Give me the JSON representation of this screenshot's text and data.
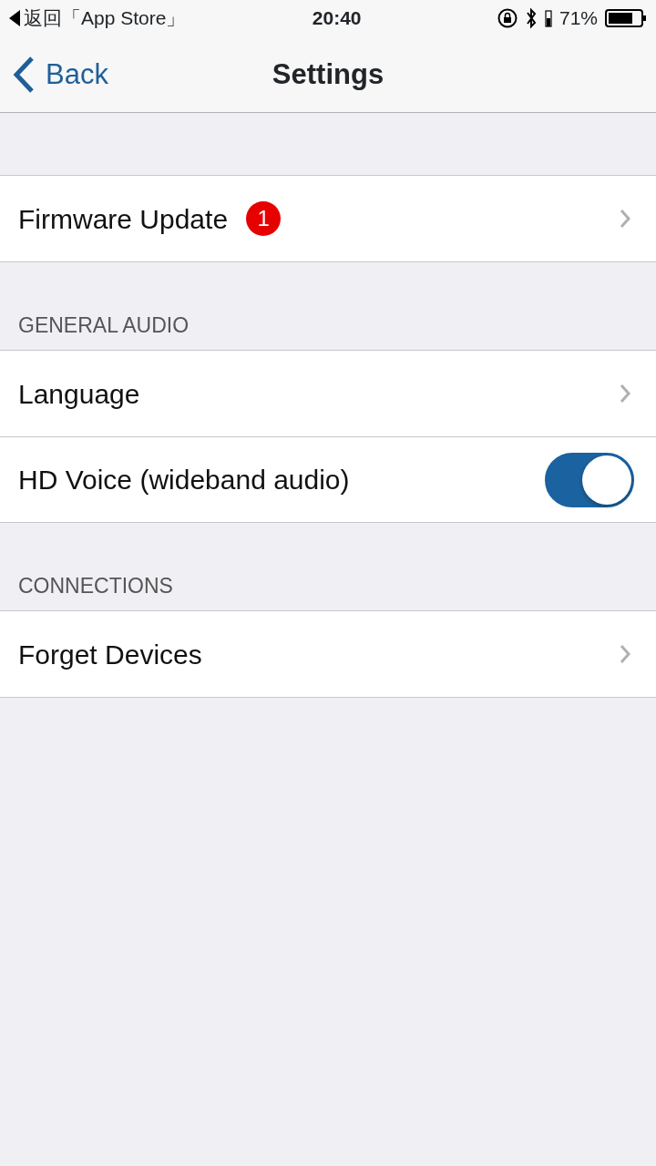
{
  "status_bar": {
    "back_app": "返回「App Store」",
    "time": "20:40",
    "battery": "71%"
  },
  "nav": {
    "back": "Back",
    "title": "Settings"
  },
  "sections": [
    {
      "rows": [
        {
          "kind": "link",
          "label": "Firmware Update",
          "badge": "1"
        }
      ]
    },
    {
      "header": "GENERAL AUDIO",
      "rows": [
        {
          "kind": "link",
          "label": "Language"
        },
        {
          "kind": "toggle",
          "label": "HD Voice (wideband audio)",
          "on": true
        }
      ]
    },
    {
      "header": "CONNECTIONS",
      "rows": [
        {
          "kind": "link",
          "label": "Forget Devices"
        }
      ]
    }
  ]
}
